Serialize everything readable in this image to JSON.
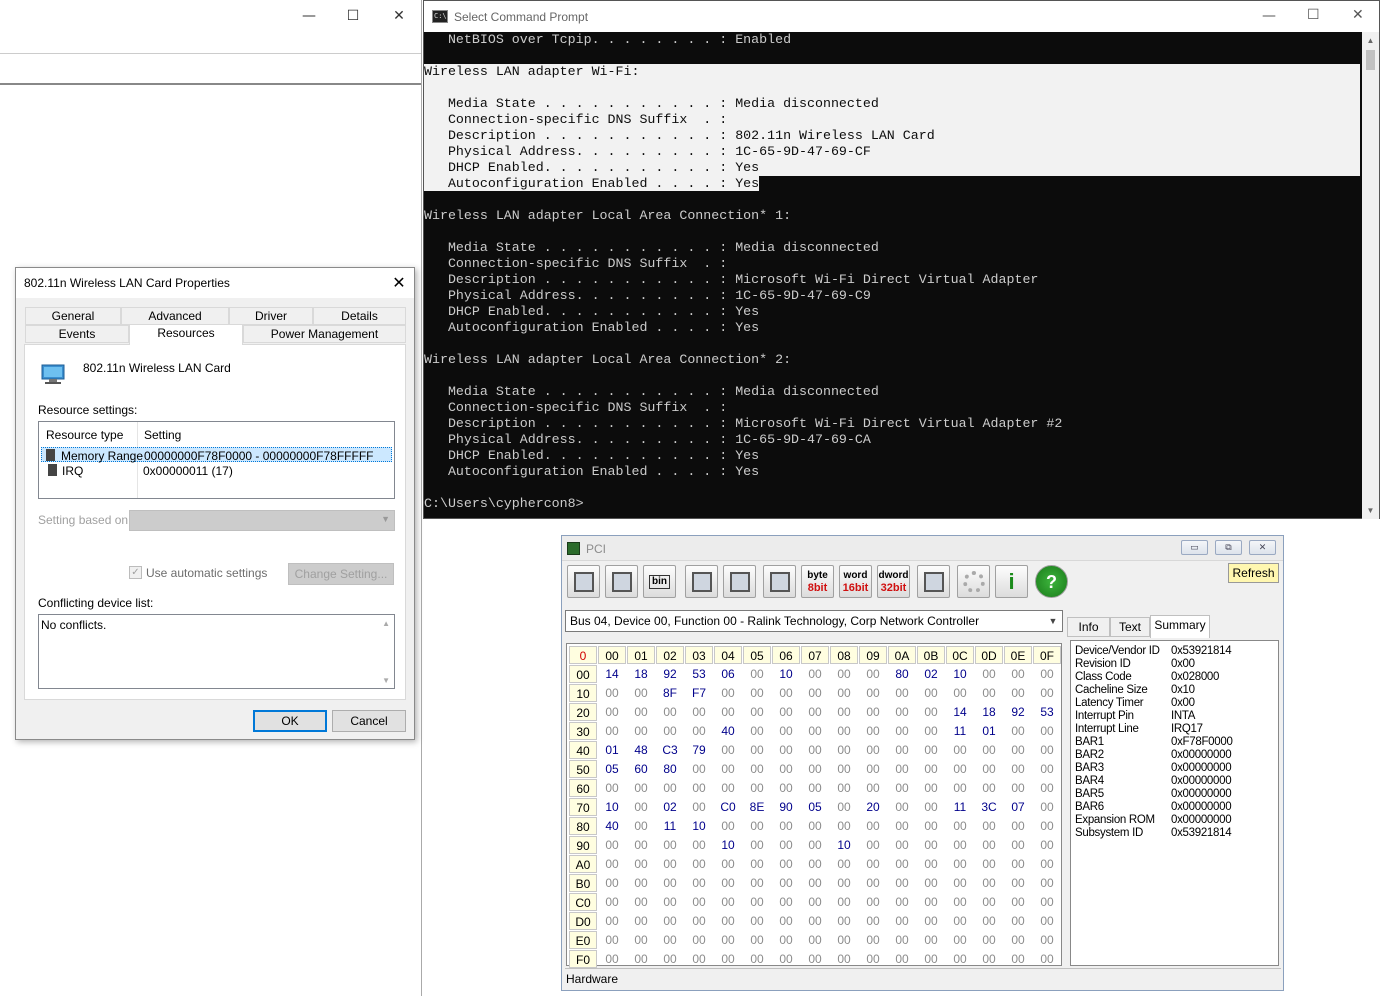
{
  "background_window": {
    "minimize": "—",
    "maximize": "☐",
    "close": "✕"
  },
  "cmd": {
    "title": "Select Command Prompt",
    "icon_text": "C:\\",
    "lines": [
      "   NetBIOS over Tcpip. . . . . . . . : Enabled",
      "",
      "Wireless LAN adapter Wi-Fi:",
      "",
      "   Media State . . . . . . . . . . . : Media disconnected",
      "   Connection-specific DNS Suffix  . :",
      "   Description . . . . . . . . . . . : 802.11n Wireless LAN Card",
      "   Physical Address. . . . . . . . . : 1C-65-9D-47-69-CF",
      "   DHCP Enabled. . . . . . . . . . . : Yes",
      "   Autoconfiguration Enabled . . . . : Yes",
      "",
      "Wireless LAN adapter Local Area Connection* 1:",
      "",
      "   Media State . . . . . . . . . . . : Media disconnected",
      "   Connection-specific DNS Suffix  . :",
      "   Description . . . . . . . . . . . : Microsoft Wi-Fi Direct Virtual Adapter",
      "   Physical Address. . . . . . . . . : 1C-65-9D-47-69-C9",
      "   DHCP Enabled. . . . . . . . . . . : Yes",
      "   Autoconfiguration Enabled . . . . : Yes",
      "",
      "Wireless LAN adapter Local Area Connection* 2:",
      "",
      "   Media State . . . . . . . . . . . : Media disconnected",
      "   Connection-specific DNS Suffix  . :",
      "   Description . . . . . . . . . . . : Microsoft Wi-Fi Direct Virtual Adapter #2",
      "   Physical Address. . . . . . . . . : 1C-65-9D-47-69-CA",
      "   DHCP Enabled. . . . . . . . . . . : Yes",
      "   Autoconfiguration Enabled . . . . : Yes",
      "",
      "C:\\Users\\cyphercon8>"
    ],
    "selected_full_lines": [
      2,
      3,
      4,
      5,
      6,
      7,
      8
    ],
    "selected_partial_line": 9
  },
  "props": {
    "title": "802.11n Wireless LAN Card Properties",
    "tabs_row1": [
      "General",
      "Advanced",
      "Driver",
      "Details"
    ],
    "tabs_row2": [
      "Events",
      "Resources",
      "Power Management"
    ],
    "active_tab": "Resources",
    "device_name": "802.11n Wireless LAN Card",
    "resource_settings_label": "Resource settings:",
    "col_type": "Resource type",
    "col_setting": "Setting",
    "resources": [
      {
        "type": "Memory Range",
        "setting": "00000000F78F0000 - 00000000F78FFFFF"
      },
      {
        "type": "IRQ",
        "setting": "0x00000011 (17)"
      }
    ],
    "setting_based_on": "Setting based on:",
    "use_auto": "Use automatic settings",
    "change_setting": "Change Setting...",
    "conflicting_label": "Conflicting device list:",
    "conflicts": "No conflicts.",
    "ok": "OK",
    "cancel": "Cancel"
  },
  "pci": {
    "title": "PCI",
    "refresh": "Refresh",
    "toolbar": [
      {
        "name": "save-icon",
        "label": ""
      },
      {
        "name": "save-all-icon",
        "label": ""
      },
      {
        "name": "bin-icon",
        "label": "bin"
      },
      {
        "name": "floppy-table-icon",
        "label": ""
      },
      {
        "name": "binoculars-icon",
        "label": ""
      },
      {
        "name": "table-icon",
        "label": ""
      },
      {
        "name": "byte-8bit-icon",
        "label": "byte",
        "sub": "8bit"
      },
      {
        "name": "word-16bit-icon",
        "label": "word",
        "sub": "16bit"
      },
      {
        "name": "dword-32bit-icon",
        "label": "dword",
        "sub": "32bit"
      },
      {
        "name": "tree-icon",
        "label": ""
      },
      {
        "name": "gear-disabled-icon",
        "label": ""
      },
      {
        "name": "info-icon",
        "label": "i"
      },
      {
        "name": "help-icon",
        "label": "?"
      }
    ],
    "device_select": "Bus 04, Device 00, Function 00 - Ralink Technology, Corp Network Controller",
    "corner": "0",
    "col_headers": [
      "00",
      "01",
      "02",
      "03",
      "04",
      "05",
      "06",
      "07",
      "08",
      "09",
      "0A",
      "0B",
      "0C",
      "0D",
      "0E",
      "0F"
    ],
    "row_headers": [
      "00",
      "10",
      "20",
      "30",
      "40",
      "50",
      "60",
      "70",
      "80",
      "90",
      "A0",
      "B0",
      "C0",
      "D0",
      "E0",
      "F0"
    ],
    "rows": [
      [
        "14",
        "18",
        "92",
        "53",
        "06",
        "00",
        "10",
        "00",
        "00",
        "00",
        "80",
        "02",
        "10",
        "00",
        "00",
        "00"
      ],
      [
        "00",
        "00",
        "8F",
        "F7",
        "00",
        "00",
        "00",
        "00",
        "00",
        "00",
        "00",
        "00",
        "00",
        "00",
        "00",
        "00"
      ],
      [
        "00",
        "00",
        "00",
        "00",
        "00",
        "00",
        "00",
        "00",
        "00",
        "00",
        "00",
        "00",
        "14",
        "18",
        "92",
        "53"
      ],
      [
        "00",
        "00",
        "00",
        "00",
        "40",
        "00",
        "00",
        "00",
        "00",
        "00",
        "00",
        "00",
        "11",
        "01",
        "00",
        "00"
      ],
      [
        "01",
        "48",
        "C3",
        "79",
        "00",
        "00",
        "00",
        "00",
        "00",
        "00",
        "00",
        "00",
        "00",
        "00",
        "00",
        "00"
      ],
      [
        "05",
        "60",
        "80",
        "00",
        "00",
        "00",
        "00",
        "00",
        "00",
        "00",
        "00",
        "00",
        "00",
        "00",
        "00",
        "00"
      ],
      [
        "00",
        "00",
        "00",
        "00",
        "00",
        "00",
        "00",
        "00",
        "00",
        "00",
        "00",
        "00",
        "00",
        "00",
        "00",
        "00"
      ],
      [
        "10",
        "00",
        "02",
        "00",
        "C0",
        "8E",
        "90",
        "05",
        "00",
        "20",
        "00",
        "00",
        "11",
        "3C",
        "07",
        "00"
      ],
      [
        "40",
        "00",
        "11",
        "10",
        "00",
        "00",
        "00",
        "00",
        "00",
        "00",
        "00",
        "00",
        "00",
        "00",
        "00",
        "00"
      ],
      [
        "00",
        "00",
        "00",
        "00",
        "10",
        "00",
        "00",
        "00",
        "10",
        "00",
        "00",
        "00",
        "00",
        "00",
        "00",
        "00"
      ],
      [
        "00",
        "00",
        "00",
        "00",
        "00",
        "00",
        "00",
        "00",
        "00",
        "00",
        "00",
        "00",
        "00",
        "00",
        "00",
        "00"
      ],
      [
        "00",
        "00",
        "00",
        "00",
        "00",
        "00",
        "00",
        "00",
        "00",
        "00",
        "00",
        "00",
        "00",
        "00",
        "00",
        "00"
      ],
      [
        "00",
        "00",
        "00",
        "00",
        "00",
        "00",
        "00",
        "00",
        "00",
        "00",
        "00",
        "00",
        "00",
        "00",
        "00",
        "00"
      ],
      [
        "00",
        "00",
        "00",
        "00",
        "00",
        "00",
        "00",
        "00",
        "00",
        "00",
        "00",
        "00",
        "00",
        "00",
        "00",
        "00"
      ],
      [
        "00",
        "00",
        "00",
        "00",
        "00",
        "00",
        "00",
        "00",
        "00",
        "00",
        "00",
        "00",
        "00",
        "00",
        "00",
        "00"
      ],
      [
        "00",
        "00",
        "00",
        "00",
        "00",
        "00",
        "00",
        "00",
        "00",
        "00",
        "00",
        "00",
        "00",
        "00",
        "00",
        "00"
      ]
    ],
    "right_tabs": [
      "Info",
      "Text",
      "Summary"
    ],
    "active_right_tab": "Summary",
    "summary": [
      [
        "Device/Vendor ID",
        "0x53921814"
      ],
      [
        "Revision ID",
        "0x00"
      ],
      [
        "Class Code",
        "0x028000"
      ],
      [
        "Cacheline Size",
        "0x10"
      ],
      [
        "Latency Timer",
        "0x00"
      ],
      [
        "Interrupt Pin",
        "INTA"
      ],
      [
        "Interrupt Line",
        "IRQ17"
      ],
      [
        "BAR1",
        "0xF78F0000"
      ],
      [
        "BAR2",
        "0x00000000"
      ],
      [
        "BAR3",
        "0x00000000"
      ],
      [
        "BAR4",
        "0x00000000"
      ],
      [
        "BAR5",
        "0x00000000"
      ],
      [
        "BAR6",
        "0x00000000"
      ],
      [
        "Expansion ROM",
        "0x00000000"
      ],
      [
        "Subsystem ID",
        "0x53921814"
      ]
    ],
    "status": "Hardware"
  }
}
